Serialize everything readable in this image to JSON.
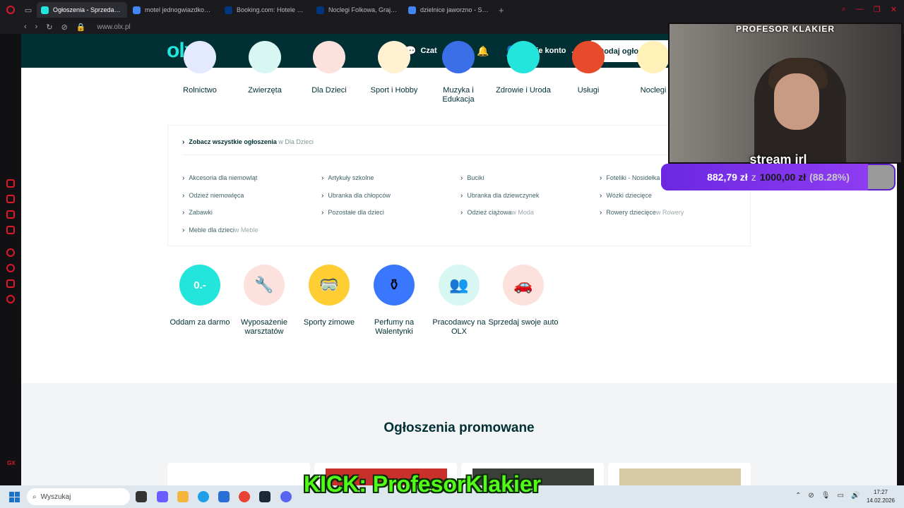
{
  "browser": {
    "tabs": [
      {
        "label": "Ogłoszenia - Sprzedam, k",
        "active": true,
        "favicon_color": "#23e5db"
      },
      {
        "label": "motel jednogwiazdkowy p",
        "active": false,
        "favicon_color": "#4285f4"
      },
      {
        "label": "Booking.com: Hotele – Gr",
        "active": false,
        "favicon_color": "#003580"
      },
      {
        "label": "Noclegi Folkowa, Grajewo",
        "active": false,
        "favicon_color": "#003580"
      },
      {
        "label": "dzielnice jaworzno - Szuk",
        "active": false,
        "favicon_color": "#4285f4"
      }
    ],
    "url": "www.olx.pl"
  },
  "olx": {
    "logo": "olx",
    "nav": {
      "chat": "Czat",
      "account": "Twoje konto"
    },
    "add_button": "Dodaj ogłoszenie",
    "categories_top": [
      {
        "label": "Rolnictwo",
        "color": "#e3e9ff"
      },
      {
        "label": "Zwierzęta",
        "color": "#d8f7f3"
      },
      {
        "label": "Dla Dzieci",
        "color": "#fde1dc"
      },
      {
        "label": "Sport i Hobby",
        "color": "#fff1d1"
      },
      {
        "label": "Muzyka i Edukacja",
        "color": "#3a6fe8"
      },
      {
        "label": "Zdrowie i Uroda",
        "color": "#23e5db"
      },
      {
        "label": "Usługi",
        "color": "#e64b2c"
      },
      {
        "label": "Noclegi",
        "color": "#fff1b8"
      }
    ],
    "subcategories": {
      "see_all": "Zobacz wszystkie ogłoszenia",
      "see_all_context": " w Dla Dzieci",
      "links": [
        {
          "label": "Akcesoria dla niemowląt",
          "suffix": ""
        },
        {
          "label": "Artykuły szkolne",
          "suffix": ""
        },
        {
          "label": "Buciki",
          "suffix": ""
        },
        {
          "label": "Foteliki - Nosidełka",
          "suffix": ""
        },
        {
          "label": "Odzież niemowlęca",
          "suffix": ""
        },
        {
          "label": "Ubranka dla chłopców",
          "suffix": ""
        },
        {
          "label": "Ubranka dla dziewczynek",
          "suffix": ""
        },
        {
          "label": "Wózki dziecięce",
          "suffix": ""
        },
        {
          "label": "Zabawki",
          "suffix": ""
        },
        {
          "label": "Pozostałe dla dzieci",
          "suffix": ""
        },
        {
          "label": "Odzież ciążowa",
          "suffix": "w Moda"
        },
        {
          "label": "Rowery dziecięce",
          "suffix": "w Rowery"
        },
        {
          "label": "Meble dla dzieci",
          "suffix": "w Meble"
        }
      ]
    },
    "categories_bottom": [
      {
        "label": "Oddam za darmo",
        "color": "#23e5db",
        "glyph": "0.-"
      },
      {
        "label": "Wyposażenie warsztatów",
        "color": "#fde1dc",
        "glyph": "🔧"
      },
      {
        "label": "Sporty zimowe",
        "color": "#ffce32",
        "glyph": "🥽"
      },
      {
        "label": "Perfumy na Walentynki",
        "color": "#3a77ff",
        "glyph": "⚱"
      },
      {
        "label": "Pracodawcy na OLX",
        "color": "#d8f7f3",
        "glyph": "👥"
      },
      {
        "label": "Sprzedaj swoje auto",
        "color": "#fde1dc",
        "glyph": "🚗"
      }
    ],
    "promoted_title": "Ogłoszenia promowane",
    "promoted_cards": [
      {
        "color": "#ffffff"
      },
      {
        "color": "#c9302c"
      },
      {
        "color": "#3a3f3a"
      },
      {
        "color": "#d8c9a7"
      }
    ]
  },
  "stream": {
    "channel_name": "PROFESOR KLAKIER",
    "label": "stream irl",
    "goal_current": "882,79 zł",
    "goal_of": "z",
    "goal_target": "1000,00 zł",
    "goal_percent_text": "(88.28%)",
    "goal_fraction": 0.8828,
    "kick_handle": "KICK: ProfesorKlakier"
  },
  "taskbar": {
    "search_placeholder": "Wyszukaj",
    "time": "17:27",
    "date": "14.02.2026"
  }
}
